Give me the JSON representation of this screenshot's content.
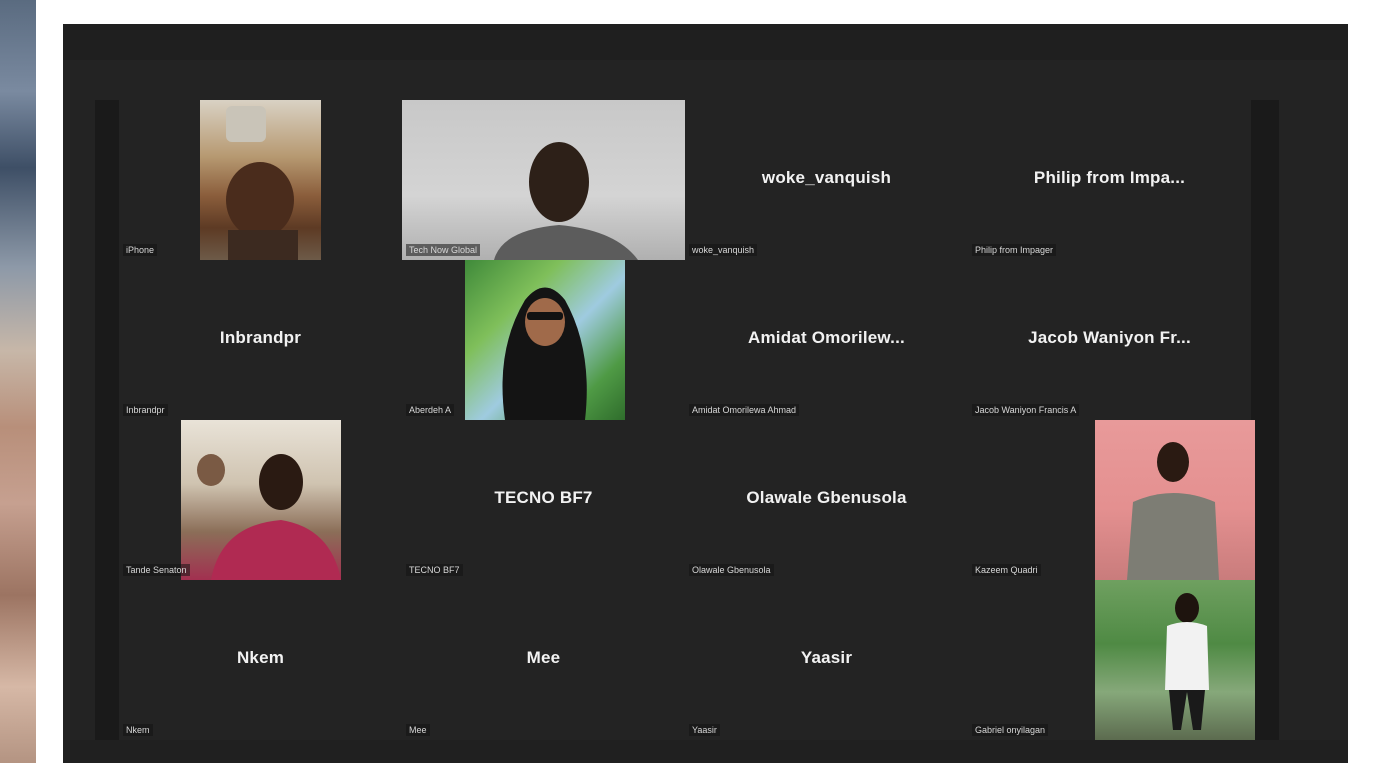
{
  "participants": [
    {
      "center": "",
      "label": "iPhone",
      "video": true
    },
    {
      "center": "",
      "label": "Tech Now Global",
      "video": true
    },
    {
      "center": "woke_vanquish",
      "label": "woke_vanquish",
      "video": false
    },
    {
      "center": "Philip from Impa...",
      "label": "Philip from Impager",
      "video": false
    },
    {
      "center": "Inbrandpr",
      "label": "Inbrandpr",
      "video": false
    },
    {
      "center": "",
      "label": "Aberdeh A",
      "video": true
    },
    {
      "center": "Amidat Omorilew...",
      "label": "Amidat Omorilewa Ahmad",
      "video": false
    },
    {
      "center": "Jacob Waniyon Fr...",
      "label": "Jacob Waniyon Francis A",
      "video": false
    },
    {
      "center": "",
      "label": "Tande Senaton",
      "video": true
    },
    {
      "center": "TECNO BF7",
      "label": "TECNO BF7",
      "video": false
    },
    {
      "center": "Olawale Gbenusola",
      "label": "Olawale Gbenusola",
      "video": false
    },
    {
      "center": "",
      "label": "Kazeem Quadri",
      "video": true
    },
    {
      "center": "Nkem",
      "label": "Nkem",
      "video": false
    },
    {
      "center": "Mee",
      "label": "Mee",
      "video": false
    },
    {
      "center": "Yaasir",
      "label": "Yaasir",
      "video": false
    },
    {
      "center": "",
      "label": "Gabriel onyilagan",
      "video": true
    }
  ]
}
